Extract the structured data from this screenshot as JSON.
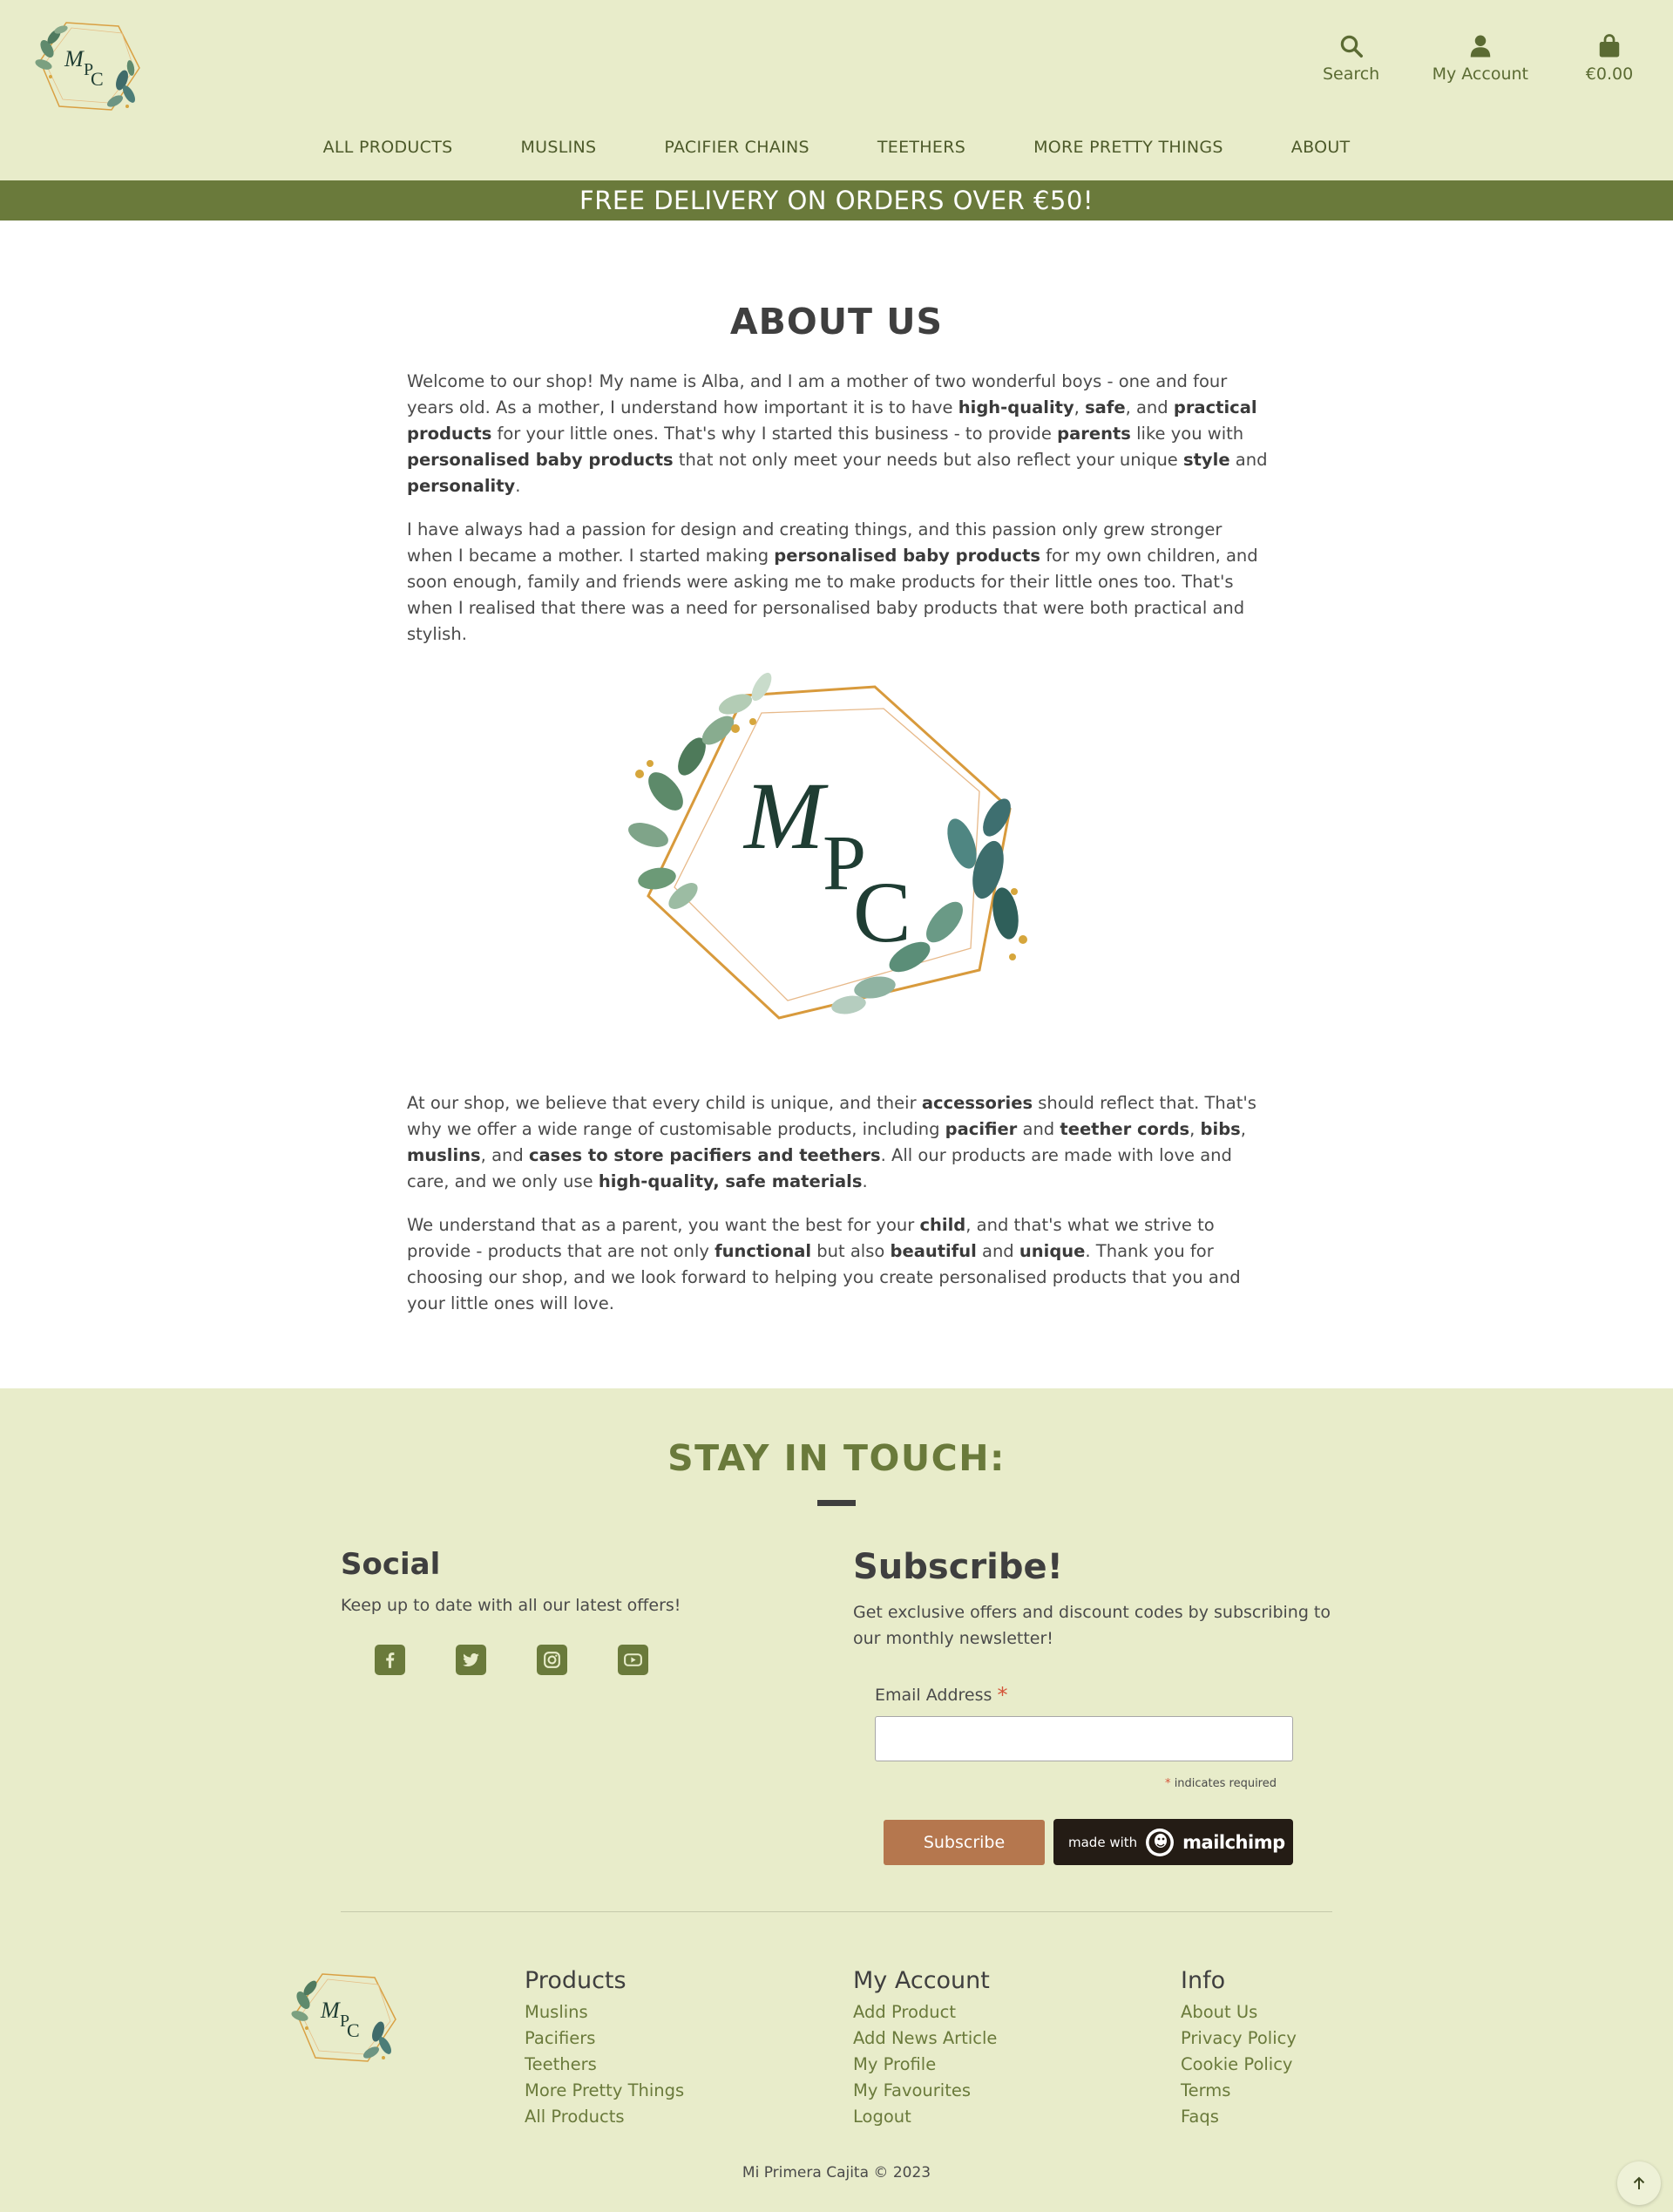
{
  "header": {
    "logo_text": "MPC",
    "actions": [
      {
        "label": "Search",
        "icon": "search-icon"
      },
      {
        "label": "My Account",
        "icon": "user-icon"
      },
      {
        "label": "€0.00",
        "icon": "shopping-bag-icon"
      }
    ],
    "nav": [
      "ALL PRODUCTS",
      "MUSLINS",
      "PACIFIER CHAINS",
      "TEETHERS",
      "MORE PRETTY THINGS",
      "ABOUT"
    ]
  },
  "banner": "FREE DELIVERY ON ORDERS OVER €50!",
  "about": {
    "title": "ABOUT US"
  },
  "footer": {
    "stay_title": "STAY IN TOUCH:",
    "social": {
      "title": "Social",
      "subtitle": "Keep up to date with all our latest offers!",
      "icons": [
        "facebook-icon",
        "twitter-icon",
        "instagram-icon",
        "youtube-icon"
      ]
    },
    "subscribe": {
      "title": "Subscribe!",
      "text": "Get exclusive offers and discount codes by subscribing to our monthly newsletter!",
      "email_label": "Email Address",
      "required_star": "*",
      "required_note": "indicates required",
      "button": "Subscribe",
      "mailchimp_made": "made with",
      "mailchimp_name": "mailchimp"
    },
    "columns": [
      {
        "title": "Products",
        "links": [
          "Muslins",
          "Pacifiers",
          "Teethers",
          "More Pretty Things",
          "All Products"
        ]
      },
      {
        "title": "My Account",
        "links": [
          "Add Product",
          "Add News Article",
          "My Profile",
          "My Favourites",
          "Logout"
        ]
      },
      {
        "title": "Info",
        "links": [
          "About Us",
          "Privacy Policy",
          "Cookie Policy",
          "Terms",
          "Faqs"
        ]
      }
    ],
    "copyright": "Mi Primera Cajita © 2023"
  },
  "colors": {
    "header_bg": "#e8ecca",
    "banner_bg": "#6a7a3b",
    "accent_green": "#6a7a3b",
    "subscribe_button": "#b5774e",
    "mailchimp_bg": "#241c15"
  }
}
